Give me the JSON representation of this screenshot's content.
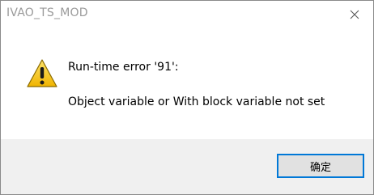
{
  "window": {
    "title": "IVAO_TS_MOD"
  },
  "titlebar": {
    "close_icon": "close-icon"
  },
  "message": {
    "icon": "warning-icon",
    "line1": "Run-time error '91':",
    "line2": "Object variable or With block variable not set"
  },
  "footer": {
    "ok_label": "确定"
  },
  "colors": {
    "focus_border": "#0078d7",
    "footer_bg": "#f0f0f0",
    "button_bg": "#e1e1e1",
    "title_text": "#9a9a9a",
    "warning_fill": "#f5c518"
  }
}
